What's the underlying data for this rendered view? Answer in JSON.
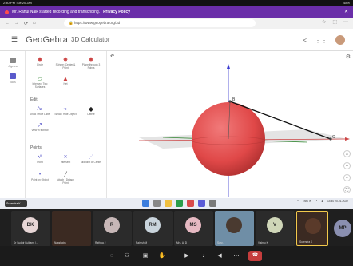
{
  "statusbar": {
    "left": "2:40 PM  Tue 20 Jan",
    "right": "48%"
  },
  "recording_banner": {
    "text": "Mr. Rahul Naik started recording and transcribing.",
    "link": "Privacy Policy"
  },
  "browser": {
    "url": "🔒 https://www.geogebra.org/3d"
  },
  "app": {
    "title": "GeoGebra",
    "subtitle": "3D Calculator"
  },
  "mini_nav": [
    {
      "label": "Algebra"
    },
    {
      "label": "Tools"
    }
  ],
  "tools": {
    "top_row": [
      {
        "glyph": "✸",
        "label": "Circle"
      },
      {
        "glyph": "✸",
        "label": "Sphere: Center & Point"
      },
      {
        "glyph": "✸",
        "label": "Plane through 3 Points"
      }
    ],
    "second_row": [
      {
        "glyph": "▱",
        "label": "Intersect Two Surfaces"
      },
      {
        "glyph": "▲",
        "label": "Net"
      }
    ],
    "edit_heading": "Edit",
    "edit": [
      {
        "glyph": "A▸",
        "label": "Show / Hide Label"
      },
      {
        "glyph": "◦▸",
        "label": "Show / Hide Object"
      },
      {
        "glyph": "◆",
        "label": "Delete"
      },
      {
        "glyph": "↗",
        "label": "View in front of"
      }
    ],
    "points_heading": "Points",
    "points": [
      {
        "glyph": "•A",
        "label": "Point"
      },
      {
        "glyph": "✕",
        "label": "Intersect"
      },
      {
        "glyph": "⋰",
        "label": "Midpoint or Center"
      },
      {
        "glyph": "•",
        "label": "Point on Object"
      },
      {
        "glyph": "╱",
        "label": "Attach / Detach Point"
      }
    ]
  },
  "view": {
    "labels": {
      "tangent_point": "B",
      "far_point": "C"
    }
  },
  "taskbar": {
    "chip": "Surendra K",
    "lang": "ENG\nIN",
    "time": "14:40\n20-01-2022"
  },
  "participants": [
    {
      "initials": "DK",
      "name": "Dr Sudhir Kulkarni (...",
      "color": "#e7d6d6"
    },
    {
      "initials": "",
      "name": "Nakshatra",
      "color": ""
    },
    {
      "initials": "R",
      "name": "Rathika J",
      "color": "#c7b7b7"
    },
    {
      "initials": "RM",
      "name": "Rajnish M",
      "color": "#c9d4dc"
    },
    {
      "initials": "MS",
      "name": "Mrs. A. D",
      "color": "#e6b9c2"
    },
    {
      "initials": "",
      "name": "Sarv...",
      "color": ""
    },
    {
      "initials": "V",
      "name": "Vishnu K",
      "color": "#cfd6b8"
    },
    {
      "initials": "",
      "name": "Surendra K",
      "color": ""
    }
  ],
  "participant_more": "MP",
  "colors": {
    "sphere": "#e04848",
    "banner": "#6a2ea8",
    "hangup": "#c53d3d"
  }
}
